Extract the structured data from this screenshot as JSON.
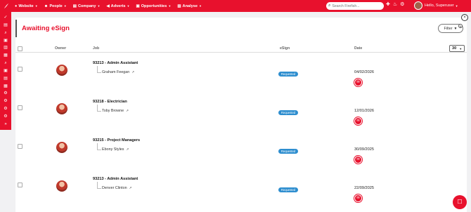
{
  "nav": {
    "items": [
      {
        "icon": "globe-icon",
        "glyph": "●",
        "label": "Website"
      },
      {
        "icon": "person-icon",
        "glyph": "☻",
        "label": "People"
      },
      {
        "icon": "building-icon",
        "glyph": "▤",
        "label": "Company"
      },
      {
        "icon": "megaphone-icon",
        "glyph": "◀",
        "label": "Adverts"
      },
      {
        "icon": "briefcase-icon",
        "glyph": "▣",
        "label": "Opportunities"
      },
      {
        "icon": "chart-icon",
        "glyph": "▥",
        "label": "Analyse"
      }
    ]
  },
  "search": {
    "placeholder": "Search Firefish..."
  },
  "user": {
    "greeting": "Hello, Superuser"
  },
  "page": {
    "title": "Awaiting eSign",
    "filter_label": "Filter",
    "filter_count": "0",
    "close": "×"
  },
  "table": {
    "headers": {
      "owner": "Owner",
      "job": "Job",
      "esign": "eSign",
      "date": "Date"
    },
    "per_page": "30",
    "rows": [
      {
        "job": "93213 - Admin Assistant",
        "candidate": "Graham Feegan",
        "status": "Requested",
        "date": "04/02/2026"
      },
      {
        "job": "93218 - Electrician",
        "candidate": "Toby Browne",
        "status": "Requested",
        "date": "12/01/2026"
      },
      {
        "job": "93215 - Project Managers",
        "candidate": "Ebony Styles",
        "status": "Requested",
        "date": "30/09/2025"
      },
      {
        "job": "93213 - Admin Assistant",
        "candidate": "Denver Clinton",
        "status": "Requested",
        "date": "22/09/2025"
      }
    ]
  },
  "colors": {
    "brand": "#e8112d",
    "badge": "#2e8ecf"
  }
}
